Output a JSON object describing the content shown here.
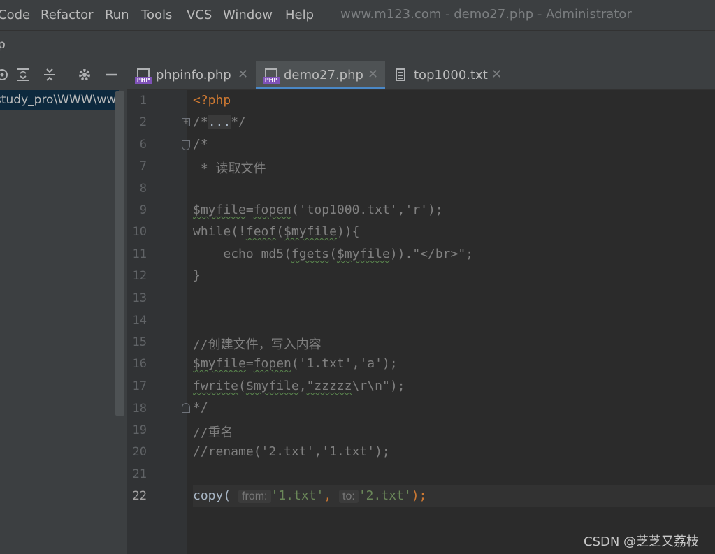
{
  "menu": {
    "items": [
      {
        "label": "Code",
        "mnemonic_index": 0
      },
      {
        "label": "Refactor",
        "mnemonic_index": 0
      },
      {
        "label": "Run",
        "mnemonic_index": 1
      },
      {
        "label": "Tools",
        "mnemonic_index": 0
      },
      {
        "label": "VCS",
        "mnemonic_index": -1
      },
      {
        "label": "Window",
        "mnemonic_index": 0
      },
      {
        "label": "Help",
        "mnemonic_index": 0
      }
    ],
    "window_title": "www.m123.com - demo27.php - Administrator"
  },
  "toolbar2": {
    "project_fragment": "p"
  },
  "project_pane": {
    "tools": [
      "locate-icon",
      "expand-all-icon",
      "collapse-all-icon",
      "gear-icon",
      "hide-icon"
    ],
    "selected_path": "study_pro\\WWW\\www"
  },
  "tabs": [
    {
      "label": "phpinfo.php",
      "icon": "php-file-icon",
      "active": false
    },
    {
      "label": "demo27.php",
      "icon": "php-file-icon",
      "active": true
    },
    {
      "label": "top1000.txt",
      "icon": "text-file-icon",
      "active": false
    }
  ],
  "editor": {
    "line_numbers": [
      "1",
      "2",
      "6",
      "7",
      "8",
      "9",
      "10",
      "11",
      "12",
      "13",
      "14",
      "15",
      "16",
      "17",
      "18",
      "19",
      "20",
      "21",
      "22"
    ],
    "current_line": "22",
    "lines": {
      "l1": "<?php",
      "l2_open": "/*",
      "l2_fold": "...",
      "l2_close": "*/",
      "l6": "/*",
      "l7": " * 读取文件",
      "l9_var": "$myfile",
      "l9_func": "fopen",
      "l9_str1": "'top1000.txt'",
      "l9_str2": "'r'",
      "l10_kw": "while",
      "l10_func": "feof",
      "l10_var": "$myfile",
      "l11_kw": "echo",
      "l11_func1": "md5",
      "l11_func2": "fgets",
      "l11_var": "$myfile",
      "l11_str": "\"</br>\"",
      "l12": "}",
      "l15": "//创建文件，写入内容",
      "l16_var": "$myfile",
      "l16_func": "fopen",
      "l16_str1": "'1.txt'",
      "l16_str2": "'a'",
      "l17_func": "fwrite",
      "l17_var": "$myfile",
      "l17_str_a": "\"zzzzz",
      "l17_str_esc": "\\r\\n",
      "l17_str_b": "\"",
      "l18": "*/",
      "l19": "//重名",
      "l20": "//rename('2.txt','1.txt');",
      "l22_func": "copy",
      "l22_hint_from": "from:",
      "l22_str1": "'1.txt'",
      "l22_hint_to": "to:",
      "l22_str2": "'2.txt'"
    }
  },
  "watermark": "CSDN @芝芝又荔枝",
  "colors": {
    "background": "#2b2b2b",
    "keyword": "#cc7832",
    "string": "#6a8759",
    "comment": "#808080",
    "active_tab_underline": "#4a88c7"
  }
}
